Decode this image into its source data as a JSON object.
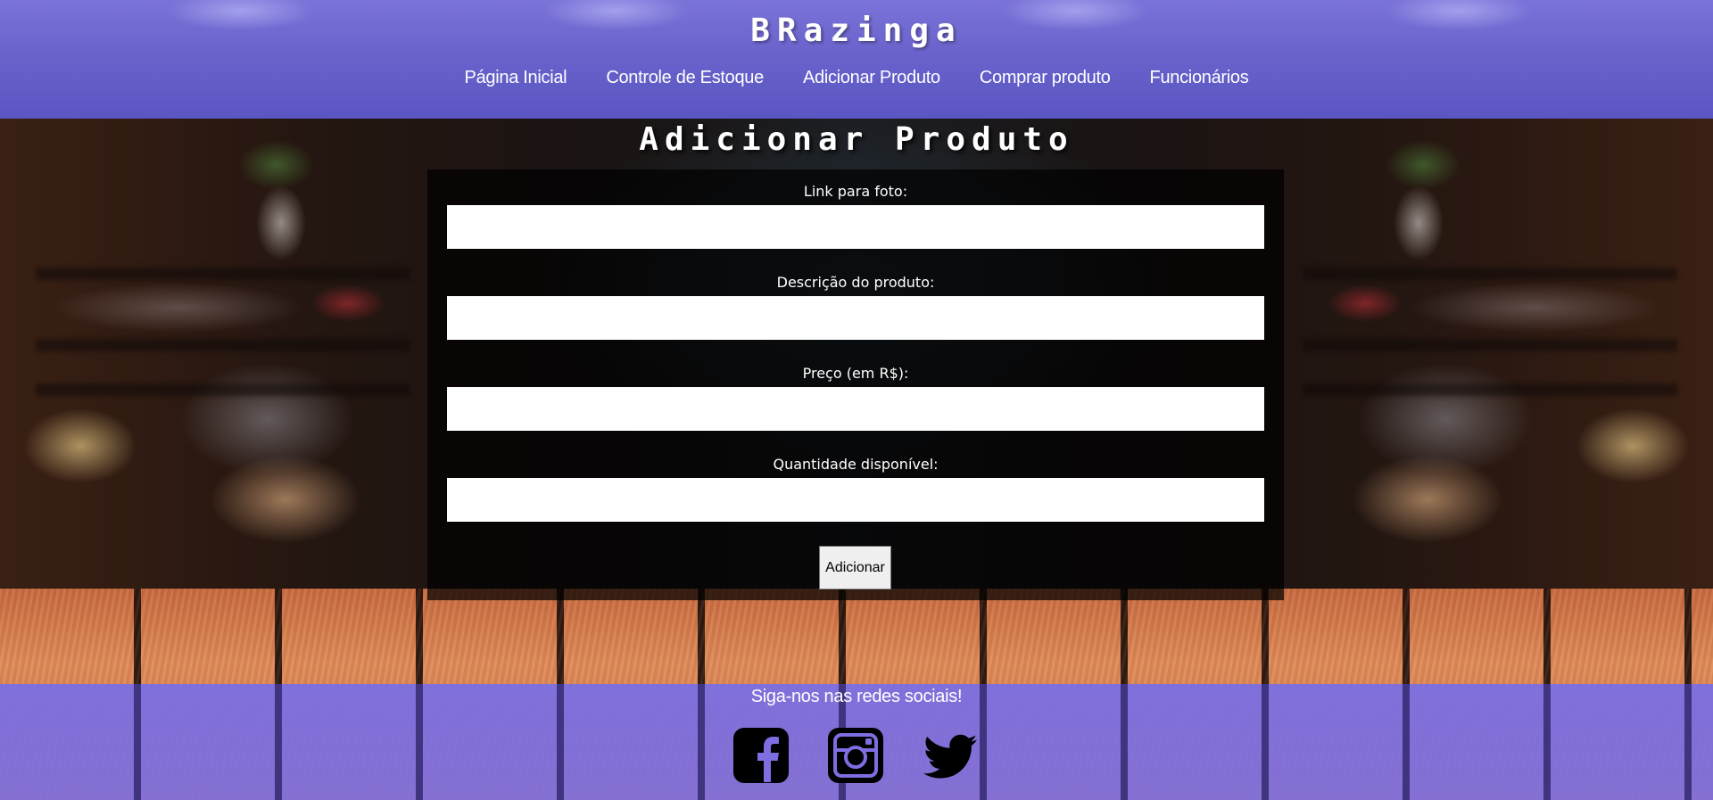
{
  "header": {
    "brand": "BRazinga",
    "nav": [
      {
        "label": "Página Inicial"
      },
      {
        "label": "Controle de Estoque"
      },
      {
        "label": "Adicionar Produto"
      },
      {
        "label": "Comprar produto"
      },
      {
        "label": "Funcionários"
      }
    ]
  },
  "main": {
    "title": "Adicionar Produto",
    "form": {
      "fields": [
        {
          "label": "Link para foto:",
          "value": "",
          "placeholder": ""
        },
        {
          "label": "Descrição do produto:",
          "value": "",
          "placeholder": ""
        },
        {
          "label": "Preço (em R$):",
          "value": "",
          "placeholder": ""
        },
        {
          "label": "Quantidade disponível:",
          "value": "",
          "placeholder": ""
        }
      ],
      "submit_label": "Adicionar"
    }
  },
  "footer": {
    "text": "Siga-nos nas redes sociais!",
    "social": [
      {
        "icon": "facebook-icon"
      },
      {
        "icon": "instagram-icon"
      },
      {
        "icon": "twitter-icon"
      }
    ]
  },
  "colors": {
    "header_bg": "#6a63cc",
    "footer_bg": "#7d6ee1",
    "panel_bg": "#000000",
    "text": "#ffffff"
  }
}
